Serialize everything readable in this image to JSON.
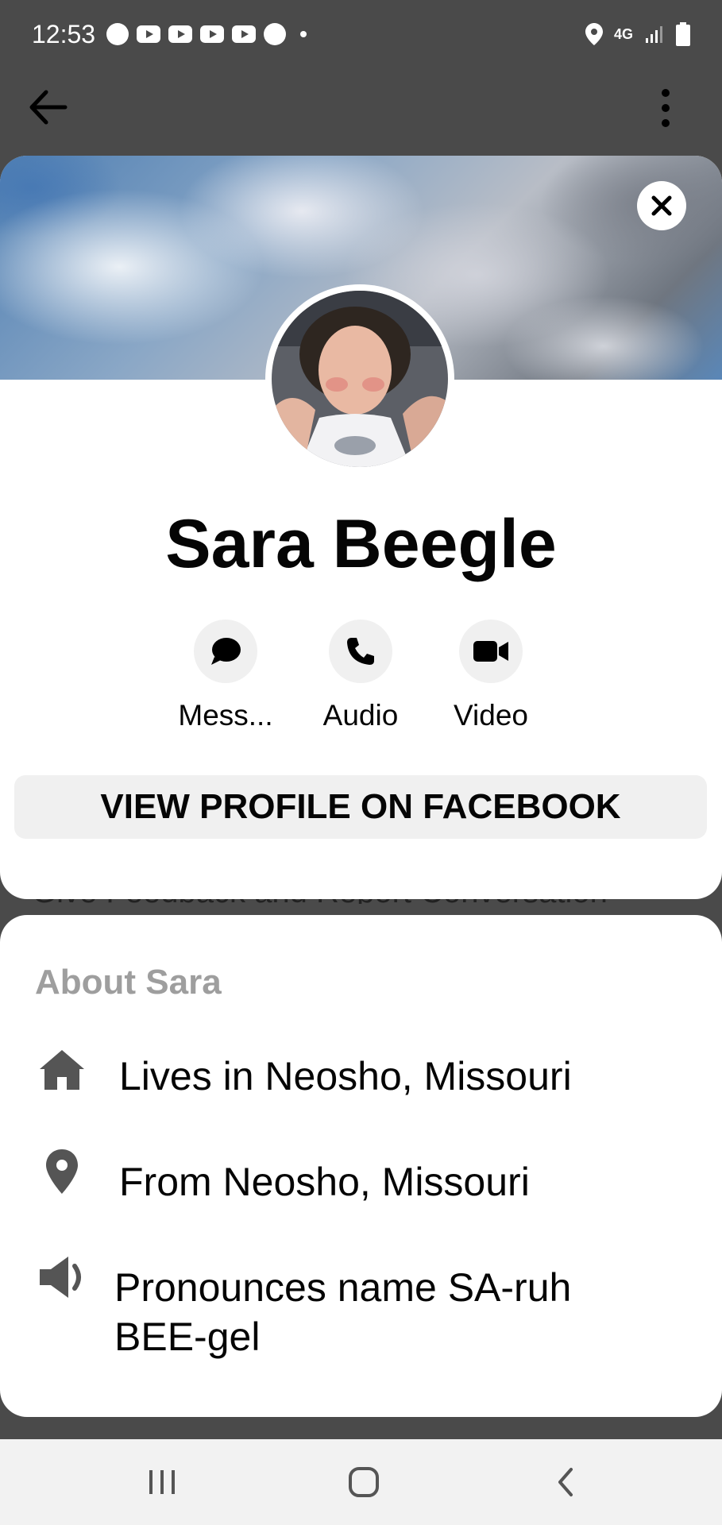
{
  "status_bar": {
    "time": "12:53",
    "network": "4G",
    "icons": [
      "chat-bubbles-icon",
      "youtube-icon",
      "youtube-icon",
      "youtube-icon",
      "youtube-icon",
      "messenger-icon",
      "location-icon",
      "signal-icon",
      "battery-icon"
    ]
  },
  "app_bar": {
    "back_icon": "arrow-left-icon",
    "menu_icon": "more-vertical-icon"
  },
  "profile": {
    "name": "Sara Beegle",
    "actions": [
      {
        "label": "Mess...",
        "icon": "chat-bubble-icon"
      },
      {
        "label": "Audio",
        "icon": "phone-icon"
      },
      {
        "label": "Video",
        "icon": "video-camera-icon"
      }
    ],
    "view_profile_label": "VIEW PROFILE ON FACEBOOK"
  },
  "peek_text": "Give Feedback and Report Conversation",
  "about": {
    "title": "About Sara",
    "items": [
      {
        "icon": "home-icon",
        "text": "Lives in Neosho, Missouri"
      },
      {
        "icon": "location-pin-icon",
        "text": "From Neosho, Missouri"
      },
      {
        "icon": "speaker-icon",
        "text": "Pronounces name SA-ruh BEE-gel"
      }
    ]
  },
  "colors": {
    "backdrop": "#4a4a4a",
    "card": "#ffffff",
    "button_bg": "#f0f0f0",
    "muted_text": "#9e9e9e",
    "text": "#050505"
  }
}
